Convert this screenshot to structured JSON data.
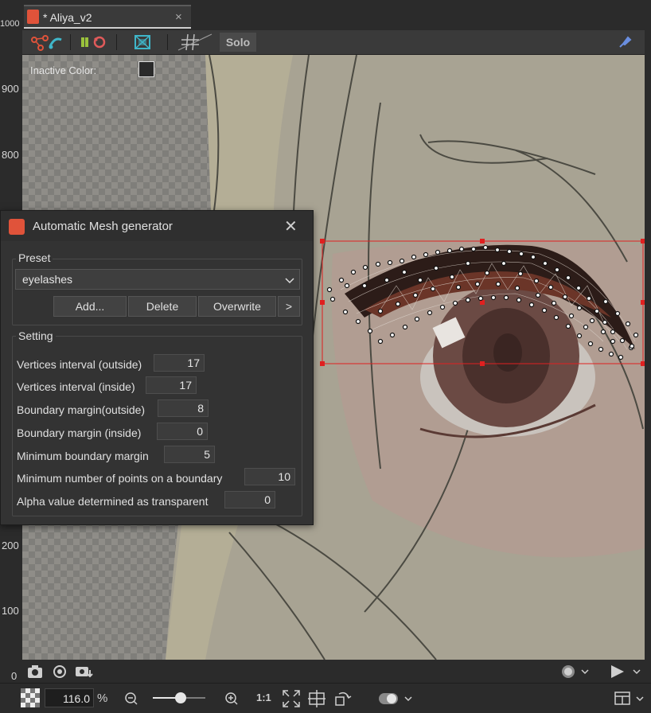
{
  "tab": {
    "title": "* Aliya_v2",
    "close": "×"
  },
  "ruler": {
    "labels": [
      "1000",
      "900",
      "800",
      "200",
      "100",
      "0"
    ]
  },
  "toolbar": {
    "solo_label": "Solo"
  },
  "canvas": {
    "inactive_color_label": "Inactive Color:"
  },
  "dialog": {
    "title": "Automatic Mesh generator",
    "close": "✕",
    "preset": {
      "group_label": "Preset",
      "selected": "eyelashes",
      "buttons": {
        "add": "Add...",
        "delete": "Delete",
        "overwrite": "Overwrite",
        "more": ">"
      }
    },
    "setting": {
      "group_label": "Setting",
      "rows": [
        {
          "label": "Vertices interval (outside)",
          "value": "17"
        },
        {
          "label": "Vertices interval (inside)",
          "value": "17"
        },
        {
          "label": "Boundary margin(outside)",
          "value": "8"
        },
        {
          "label": "Boundary margin (inside)",
          "value": "0"
        },
        {
          "label": "Minimum boundary margin",
          "value": "5"
        },
        {
          "label": "Minimum number of points on a boundary",
          "value": "10"
        },
        {
          "label": "Alpha value determined as transparent",
          "value": "0"
        }
      ]
    }
  },
  "status": {
    "zoom_value": "116.0",
    "zoom_unit": "%",
    "one_to_one": "1:1"
  },
  "colors": {
    "accent_red": "#e0533a",
    "selection_red": "#e02020"
  }
}
